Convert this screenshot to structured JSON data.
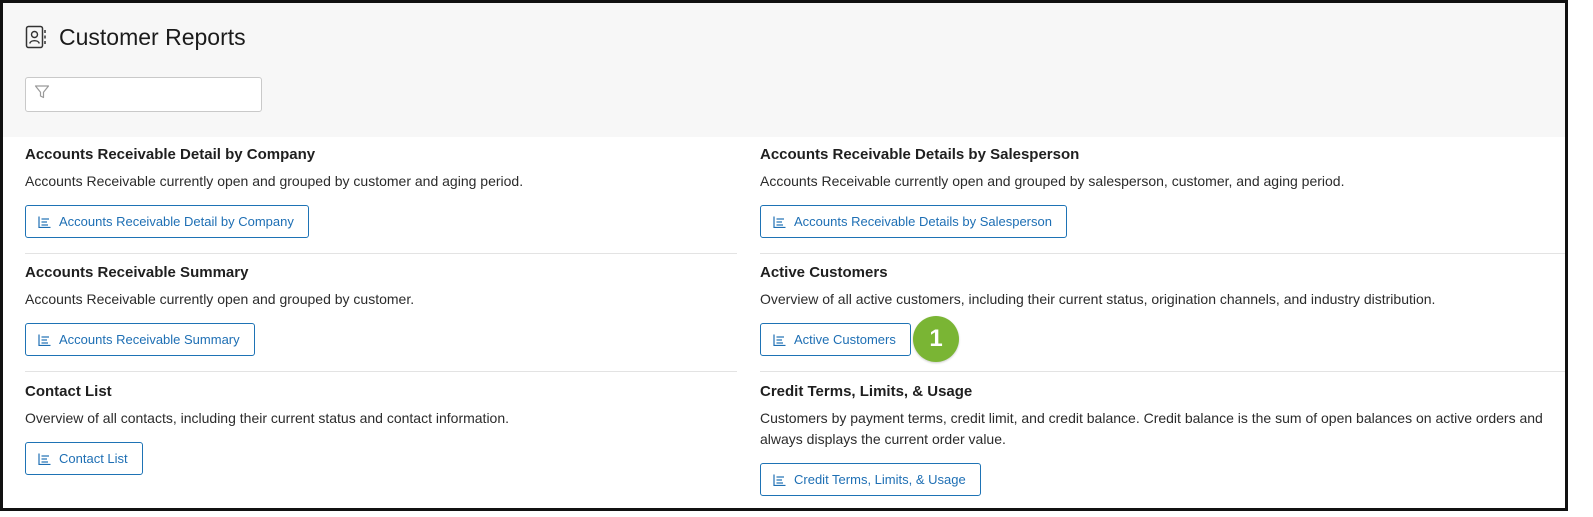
{
  "page": {
    "title": "Customer Reports",
    "filter_placeholder": ""
  },
  "reports": [
    {
      "title": "Accounts Receivable Detail by Company",
      "description": "Accounts Receivable currently open and grouped by customer and aging period.",
      "button_label": "Accounts Receivable Detail by Company"
    },
    {
      "title": "Accounts Receivable Details by Salesperson",
      "description": "Accounts Receivable currently open and grouped by salesperson, customer, and aging period.",
      "button_label": "Accounts Receivable Details by Salesperson"
    },
    {
      "title": "Accounts Receivable Summary",
      "description": "Accounts Receivable currently open and grouped by customer.",
      "button_label": "Accounts Receivable Summary"
    },
    {
      "title": "Active Customers",
      "description": "Overview of all active customers, including their current status, origination channels, and industry distribution.",
      "button_label": "Active Customers"
    },
    {
      "title": "Contact List",
      "description": "Overview of all contacts, including their current status and contact information.",
      "button_label": "Contact List"
    },
    {
      "title": "Credit Terms, Limits, & Usage",
      "description": "Customers by payment terms, credit limit, and credit balance. Credit balance is the sum of open balances on active orders and always displays the current order value.",
      "button_label": "Credit Terms, Limits, & Usage"
    }
  ],
  "step_badge": "1",
  "colors": {
    "button_border": "#1e73b5",
    "button_text": "#1e6fb4",
    "badge": "#7ab534",
    "header_bg": "#f7f7f7"
  },
  "icons": {
    "header": "contact-book-icon",
    "filter": "filter-icon",
    "report_button": "bar-chart-icon"
  }
}
